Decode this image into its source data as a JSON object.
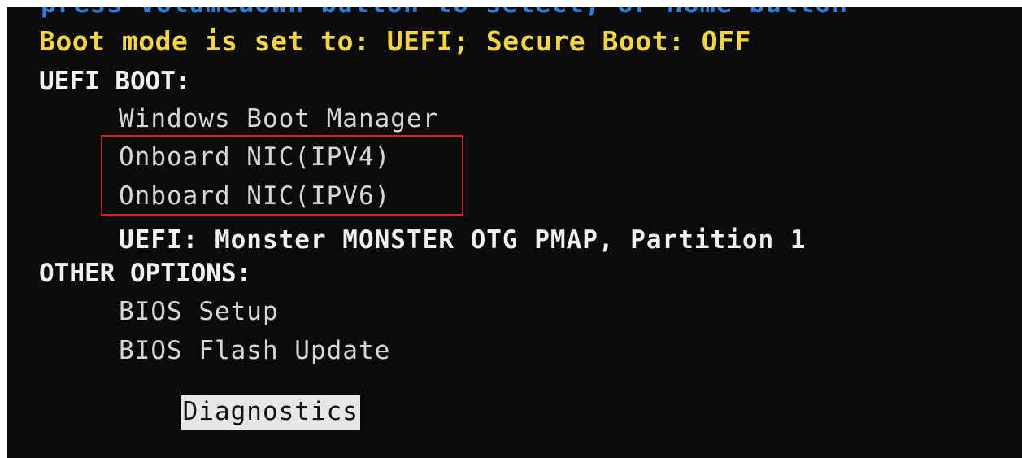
{
  "instruction": "press Volumedown button to select, or Home button",
  "status_line": "Boot mode is set to: UEFI; Secure Boot: OFF",
  "uefi_boot": {
    "header": "UEFI BOOT:",
    "items": [
      "Windows Boot Manager",
      "Onboard NIC(IPV4)",
      "Onboard NIC(IPV6)",
      "UEFI: Monster MONSTER OTG PMAP, Partition 1"
    ]
  },
  "other_options": {
    "header": "OTHER OPTIONS:",
    "items": [
      "BIOS Setup",
      "BIOS Flash Update",
      "Diagnostics"
    ],
    "selected": "Diagnostics"
  },
  "colors": {
    "background": "#0b0b0b",
    "instruction": "#2b7fe0",
    "status": "#f2d545",
    "highlight_box": "#d0232a",
    "selection_bg": "#e6e6e6"
  }
}
